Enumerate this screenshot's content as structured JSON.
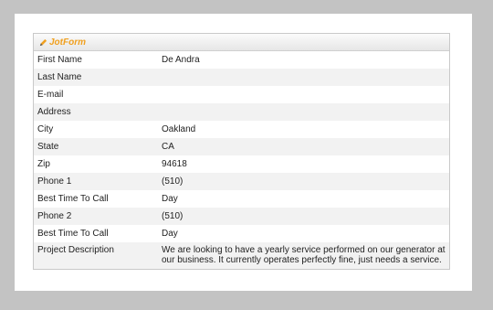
{
  "header": {
    "logo_text": "JotForm"
  },
  "rows": [
    {
      "label": "First Name",
      "value": "De Andra"
    },
    {
      "label": "Last Name",
      "value": ""
    },
    {
      "label": "E-mail",
      "value": ""
    },
    {
      "label": "Address",
      "value": ""
    },
    {
      "label": "City",
      "value": "Oakland"
    },
    {
      "label": "State",
      "value": "CA"
    },
    {
      "label": "Zip",
      "value": "94618"
    },
    {
      "label": "Phone 1",
      "value": "(510)"
    },
    {
      "label": "Best Time To Call",
      "value": "Day"
    },
    {
      "label": "Phone 2",
      "value": "(510)"
    },
    {
      "label": "Best Time To Call",
      "value": "Day"
    },
    {
      "label": "Project Description",
      "value": "We are looking to have a yearly service performed on our generator at our business.  It currently operates perfectly fine, just needs a service."
    }
  ]
}
